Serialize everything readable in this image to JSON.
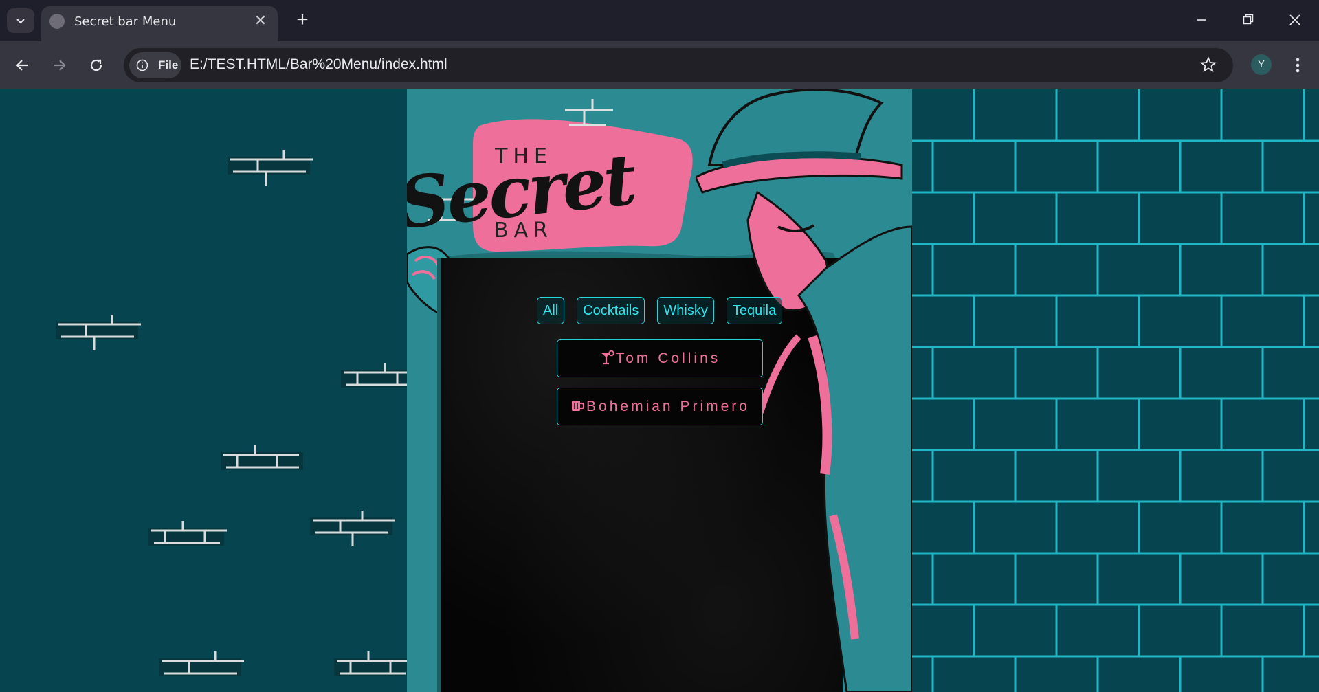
{
  "browser": {
    "tab_title": "Secret bar Menu",
    "address_chip": "File",
    "url": "E:/TEST.HTML/Bar%20Menu/index.html",
    "profile_initial": "Y"
  },
  "logo": {
    "top": "THE",
    "main": "Secret",
    "bottom": "BAR"
  },
  "filters": [
    "All",
    "Cocktails",
    "Whisky",
    "Tequila"
  ],
  "drinks": [
    {
      "name": "Tom Collins",
      "icon": "cocktail-glass-icon"
    },
    {
      "name": "Bohemian Primero",
      "icon": "beer-mug-icon"
    }
  ],
  "colors": {
    "accent_cyan": "#2ee6ee",
    "accent_pink": "#ee6f9a",
    "background_teal": "#06444f",
    "board_black": "#050505"
  }
}
